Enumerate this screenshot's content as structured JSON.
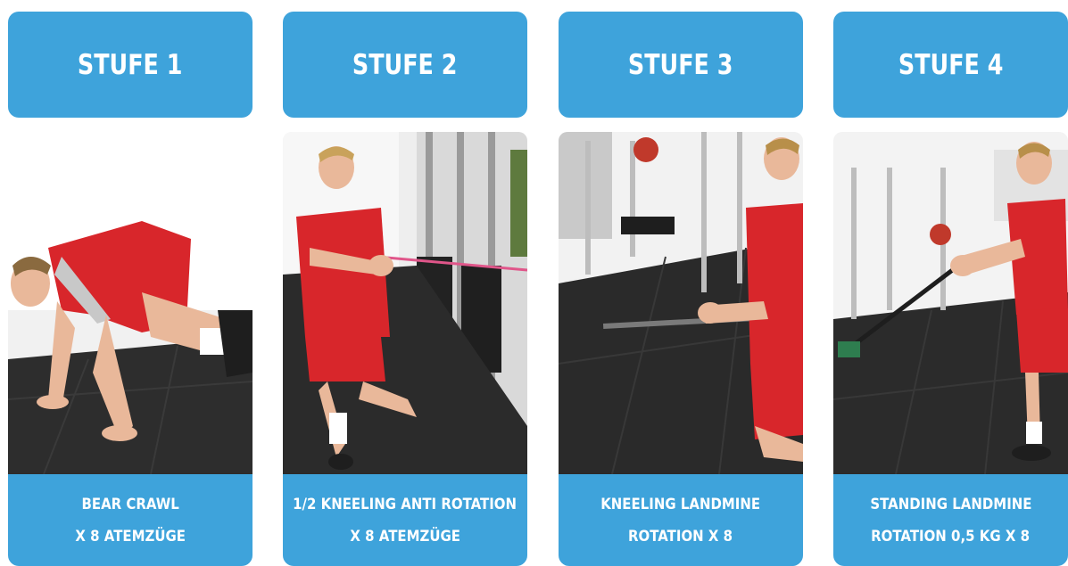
{
  "cards": [
    {
      "title": "STUFE 1",
      "line1": "BEAR CRAWL",
      "line2": "X 8 ATEMZÜGE"
    },
    {
      "title": "STUFE 2",
      "line1": "1/2 KNEELING ANTI ROTATION",
      "line2": "X 8 ATEMZÜGE"
    },
    {
      "title": "STUFE 3",
      "line1": "KNEELING LANDMINE",
      "line2": "ROTATION X 8"
    },
    {
      "title": "STUFE 4",
      "line1": "STANDING LANDMINE",
      "line2": "ROTATION 0,5 KG X 8"
    }
  ],
  "colors": {
    "accent": "#3ea3db",
    "jersey": "#d8262b",
    "floor": "#2b2b2b"
  }
}
